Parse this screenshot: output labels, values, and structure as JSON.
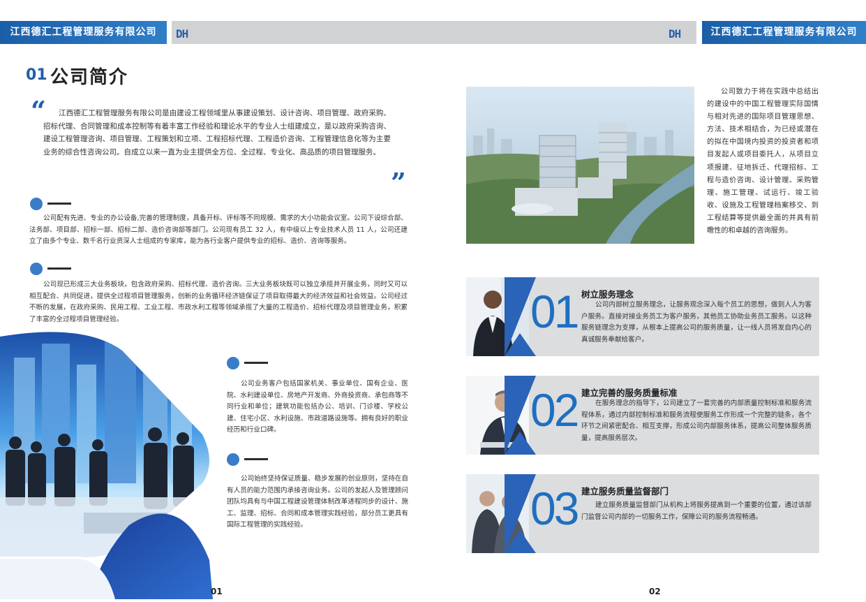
{
  "header": {
    "company_left": "江西德汇工程管理服务有限公司",
    "logo_left": "DH",
    "logo_right": "DH",
    "company_right": "江西德汇工程管理服务有限公司"
  },
  "section": {
    "number": "01",
    "title": "公司简介"
  },
  "quote": {
    "open_mark": "“",
    "close_mark": "”",
    "text": "江西德汇工程管理服务有限公司是由建设工程领域里从事建设策划、设计咨询、项目管理、政府采购、招标代理、合同管理和成本控制等有着丰富工作经验和理论水平的专业人士组建成立，是以政府采购咨询、建设工程管理咨询、项目管理、工程策划和立项、工程招标代理、工程造价咨询、工程管理信息化等为主要业务的综合性咨询公司。自成立以来一直为业主提供全方位、全过程、专业化、高品质的项目管理服务。"
  },
  "paragraphs": {
    "p1": "公司配有先进、专业的办公设备,完善的管理制度，具备开标、评标等不同规模、需求的大小功能会议室。公司下设综合部、法务部、项目部、招标一部、招标二部、造价咨询部等部门。公司现有员工 32 人，有中级以上专业技术人员 11 人，公司还建立了由多个专业、数千名行业资深人士组成的专家库，能为各行业客户提供专业的招标、造价、咨询等服务。",
    "p2": "公司现已形成三大业务板块，包含政府采购、招标代理、造价咨询。三大业务板块既可以独立承揽并开展业务，同时又可以相互配合、共同促进，提供全过程项目管理服务，创新的业务循环经济链保证了项目取得最大的经济效益和社会效益。公司经过不断的发展，在政府采购、民用工程、工业工程、市政水利工程等领域承揽了大量的工程造价、招标代理及项目管理业务，积累了丰富的全过程项目管理经验。",
    "p3": "公司业务客户包括国家机关、事业单位、国有企业、医院、水利建设单位、房地产开发商、外商投资商、承包商等不同行业和单位；建筑功能包括办公、培训、门诊楼、学校公建、住宅小区、水利设施、市政道路设施等。拥有良好的职业经历和行业口碑。",
    "p4": "公司始终坚持保证质量、稳步发展的创业原则，坚持在自有人员的能力范围内承接咨询业务。公司的发起人及管理顾问团队均具有与中国工程建设管理体制改革进程同步的设计、施工、监理、招标、合同和成本管理实践经验，部分员工更具有国际工程管理的实践经验。",
    "right_intro": "公司致力于将在实践中总结出的建设中的中国工程管理实际国情与相对先进的国际项目管理思想、方法、技术相结合，为已经或潜在的拟在中国境内投资的投资者和项目发起人或项目委托人，从项目立项报建、征地拆迁、代理招标、工程与造价咨询、设计管理、采购管理、施工管理、试运行、竣工验收、设施及工程管理档案移交、到工程结算等提供最全面的并具有前瞻性的和卓越的咨询服务。"
  },
  "cards": [
    {
      "number": "01",
      "title": "树立服务理念",
      "text": "公司内部树立服务理念，让服务观念深入每个员工的思想，做到人人为客户服务。直接对接业务员工为客户服务，其他员工协助业务员工服务。以这种服务链理念为支撑，从根本上提高公司的服务质量，让一线人员将发自内心的真诚服务奉献给客户。"
    },
    {
      "number": "02",
      "title": "建立完善的服务质量标准",
      "text": "在服务理念的指导下，公司建立了一套完善的内部质量控制标准和服务流程体系，通过内部控制标准和服务流程使服务工作形成一个完整的链条，各个环节之间紧密配合、相互支撑，形成公司内部服务体系，提高公司整体服务质量，提高服务层次。"
    },
    {
      "number": "03",
      "title": "建立服务质量监督部门",
      "text": "建立服务质量监督部门从机构上将服务提高到一个重要的位置，通过该部门监督公司内部的一切服务工作，保障公司的服务流程畅通。"
    }
  ],
  "pages": {
    "left": "01",
    "right": "02"
  },
  "colors": {
    "brand_blue": "#1f5fa8",
    "accent_blue": "#3a7cc8",
    "header_gray": "#d1d2d4",
    "card_gray": "#dcdddf"
  }
}
